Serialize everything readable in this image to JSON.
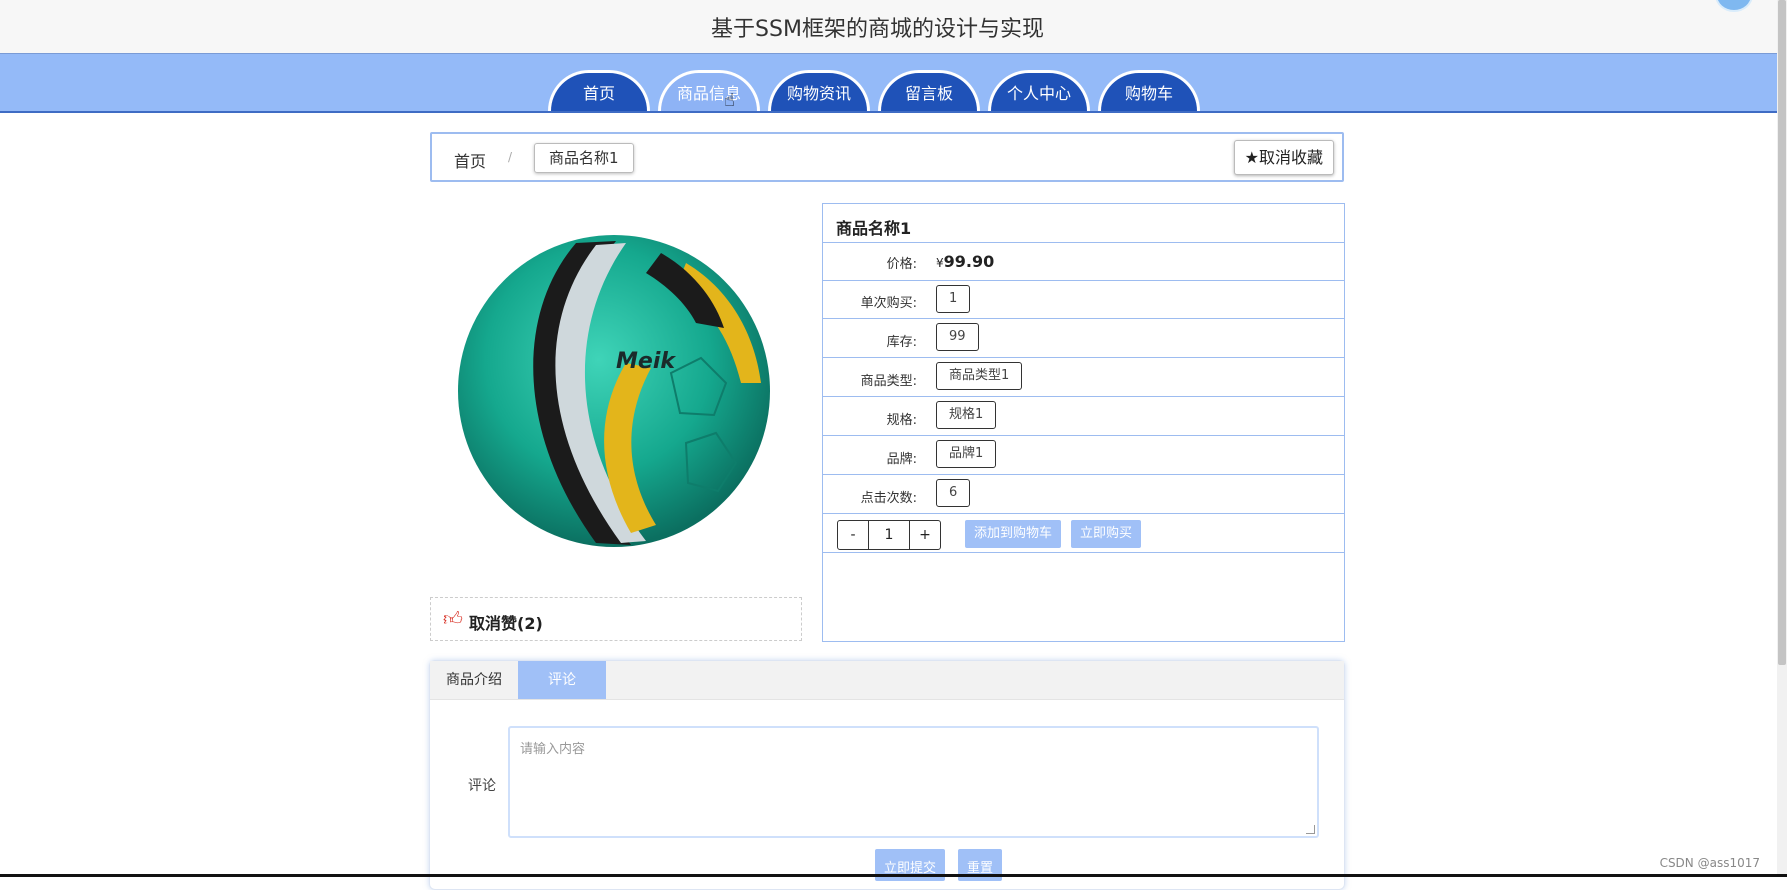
{
  "site": {
    "title": "基于SSM框架的商城的设计与实现"
  },
  "nav": {
    "tabs": [
      {
        "label": "首页"
      },
      {
        "label": "商品信息",
        "active": true
      },
      {
        "label": "购物资讯"
      },
      {
        "label": "留言板"
      },
      {
        "label": "个人中心"
      },
      {
        "label": "购物车"
      }
    ]
  },
  "breadcrumb": {
    "home": "首页",
    "separator": "/",
    "current": "商品名称1"
  },
  "favorite": {
    "label": "★取消收藏"
  },
  "product": {
    "name": "商品名称1",
    "price_label": "价格:",
    "currency": "¥",
    "price": "99.90",
    "fields": [
      {
        "label": "单次购买:",
        "value": "1"
      },
      {
        "label": "库存:",
        "value": "99"
      },
      {
        "label": "商品类型:",
        "value": "商品类型1"
      },
      {
        "label": "规格:",
        "value": "规格1"
      },
      {
        "label": "品牌:",
        "value": "品牌1"
      },
      {
        "label": "点击次数:",
        "value": "6"
      }
    ],
    "quantity": {
      "minus": "-",
      "value": "1",
      "plus": "+"
    },
    "add_cart_label": "添加到购物车",
    "buy_now_label": "立即购买",
    "image_brand_text": "Meik"
  },
  "like": {
    "label": "取消赞(2)"
  },
  "tabs": {
    "items": [
      {
        "label": "商品介绍"
      },
      {
        "label": "评论",
        "active": true
      }
    ]
  },
  "comment": {
    "label": "评论",
    "placeholder": "请输入内容",
    "submit_label": "立即提交",
    "reset_label": "重置"
  },
  "watermark": "CSDN @ass1017",
  "colors": {
    "nav_bar": "#94baf8",
    "nav_tab": "#1f52b8",
    "accent_light": "#a0c0f7",
    "border_blue": "#9dbcf0"
  }
}
